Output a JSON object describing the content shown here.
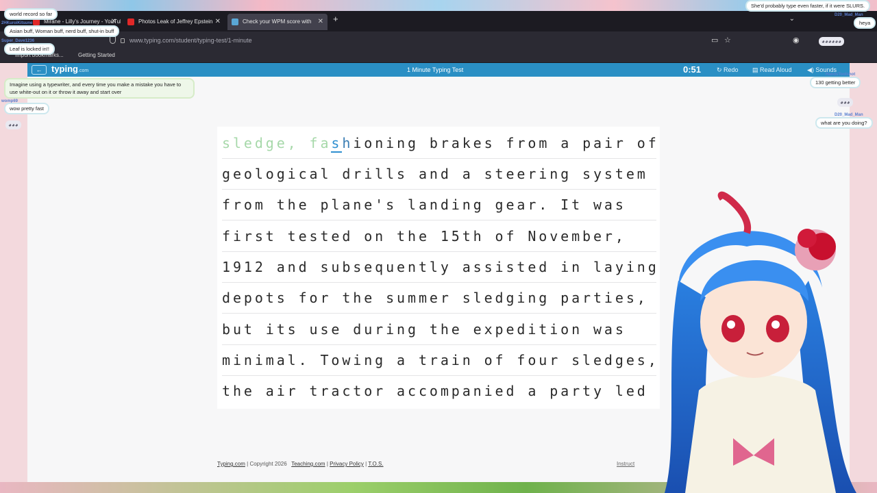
{
  "browser": {
    "tabs": [
      {
        "label": "Mirane - Lilly's Journey - YouTube",
        "active": false,
        "icon": "youtube-icon"
      },
      {
        "label": "Photos Leak of Jeffrey Epstein",
        "active": false,
        "icon": "youtube-icon"
      },
      {
        "label": "Check your WPM score with",
        "active": true,
        "icon": "typing-icon"
      }
    ],
    "url_domain": "www.typing.com",
    "url_path": "/student/typing-test/1-minute",
    "bookmarks": [
      "Import bookmarks...",
      "Getting Started"
    ]
  },
  "site": {
    "back_label": "←",
    "logo": "typing",
    "logo_suffix": ".com",
    "title": "1 Minute Typing Test",
    "timer": "0:51",
    "redo_label": "Redo",
    "read_aloud_label": "Read Aloud",
    "sounds_label": "Sounds"
  },
  "test": {
    "typed": "sledge, fa",
    "current": "s",
    "next": "h",
    "line1_rest": "ioning brakes from a pair of",
    "lines": [
      "geological drills and a steering system",
      "from the plane's landing gear. It was",
      "first tested on the 15th of November,",
      "1912 and subsequently assisted in laying",
      "depots for the summer sledging parties,",
      "but its use during the expedition was",
      "minimal. Towing a train of four sledges,",
      "the air tractor accompanied a party led"
    ]
  },
  "footer": {
    "brand": "Typing.com",
    "copyright": "| Copyright 2026",
    "teaching": "Teaching.com",
    "privacy": "Privacy Policy",
    "tos": "T.O.S.",
    "right": "Instruct"
  },
  "chat_left": [
    {
      "text": "world record so far"
    },
    {
      "user": "2HKuroiKitsune",
      "text": "Asian buff, Woman buff, nerd buff, shut-in buff"
    },
    {
      "user": "Super_Dave1236",
      "text": "Leaf is locked in!!"
    },
    {
      "text": "Imagine using a typewriter, and every time you make a mistake you have to use white-out on it or throw it away and start over"
    },
    {
      "user": "womp69",
      "text": "wow pretty fast"
    }
  ],
  "chat_right": [
    {
      "text": "She'd probably type even faster, if it were SLURS."
    },
    {
      "user": "D20_Mad_Man",
      "text": "heya"
    },
    {
      "user": "HandsToolshot",
      "text": "130 getting better"
    },
    {
      "user": "D20_Mad_Man",
      "text": "what are you doing?"
    }
  ]
}
